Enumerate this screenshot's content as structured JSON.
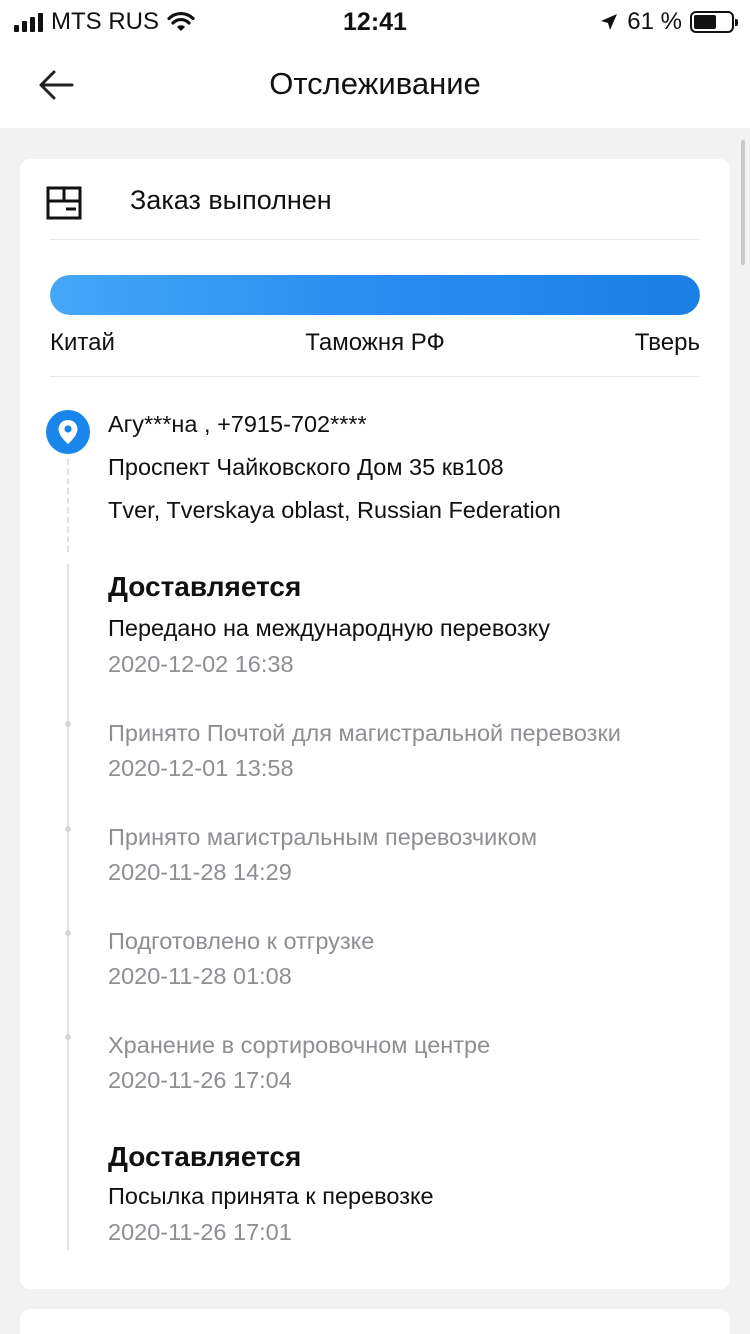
{
  "status_bar": {
    "carrier": "MTS RUS",
    "time": "12:41",
    "battery_percent": "61 %",
    "battery_level": 0.61
  },
  "nav": {
    "title": "Отслеживание"
  },
  "order": {
    "status": "Заказ выполнен",
    "progress": {
      "fraction": 1.0,
      "stages": [
        "Китай",
        "Таможня РФ",
        "Тверь"
      ]
    },
    "address": {
      "recipient": "Агу***на , +7915-702****",
      "street": "Проспект Чайковского Дом 35 кв108",
      "city": "Tver, Tverskaya oblast, Russian Federation"
    },
    "events": [
      {
        "title": "Доставляется",
        "text": "Передано на международную перевозку",
        "time": "2020-12-02 16:38"
      },
      {
        "title": "",
        "text": "Принято Почтой для магистральной перевозки",
        "time": "2020-12-01 13:58"
      },
      {
        "title": "",
        "text": "Принято магистральным перевозчиком",
        "time": "2020-11-28 14:29"
      },
      {
        "title": "",
        "text": "Подготовлено к отгрузке",
        "time": "2020-11-28 01:08"
      },
      {
        "title": "",
        "text": "Хранение в сортировочном центре",
        "time": "2020-11-26 17:04"
      },
      {
        "title": "Доставляется",
        "text": "Посылка принята к перевозке",
        "time": "2020-11-26 17:01"
      }
    ]
  },
  "colors": {
    "accent": "#1a86ec",
    "muted_text": "#8e8e93",
    "background": "#f2f2f2"
  },
  "icons": [
    "back-arrow-icon",
    "box-icon",
    "location-pin-icon",
    "wifi-icon",
    "location-arrow-icon",
    "battery-icon",
    "signal-icon"
  ]
}
